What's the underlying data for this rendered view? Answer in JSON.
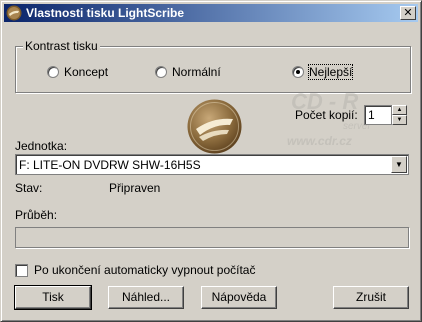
{
  "window": {
    "title": "Vlastnosti tisku LightScribe",
    "close_glyph": "✕"
  },
  "contrast": {
    "legend": "Kontrast tisku",
    "options": [
      "Koncept",
      "Normální",
      "Nejlepší"
    ],
    "selected": "Nejlepší"
  },
  "copies": {
    "label": "Počet kopií:",
    "value": "1"
  },
  "drive": {
    "label": "Jednotka:",
    "value": "F: LITE-ON  DVDRW SHW-16H5S"
  },
  "status": {
    "label": "Stav:",
    "value": "Připraven"
  },
  "progress": {
    "label": "Průběh:",
    "fraction": 0
  },
  "shutdown": {
    "label": "Po ukončení automaticky vypnout počítač",
    "checked": false
  },
  "buttons": {
    "print": "Tisk",
    "preview": "Náhled...",
    "help": "Nápověda",
    "cancel": "Zrušit"
  },
  "watermark": {
    "line1": "CD - R",
    "line2": "server",
    "line3": "www.cdr.cz"
  },
  "icons": {
    "app": "lightscribe-logo-icon",
    "dropdown": "chevron-down-icon",
    "spin_up": "spin-up-icon",
    "spin_down": "spin-down-icon"
  }
}
